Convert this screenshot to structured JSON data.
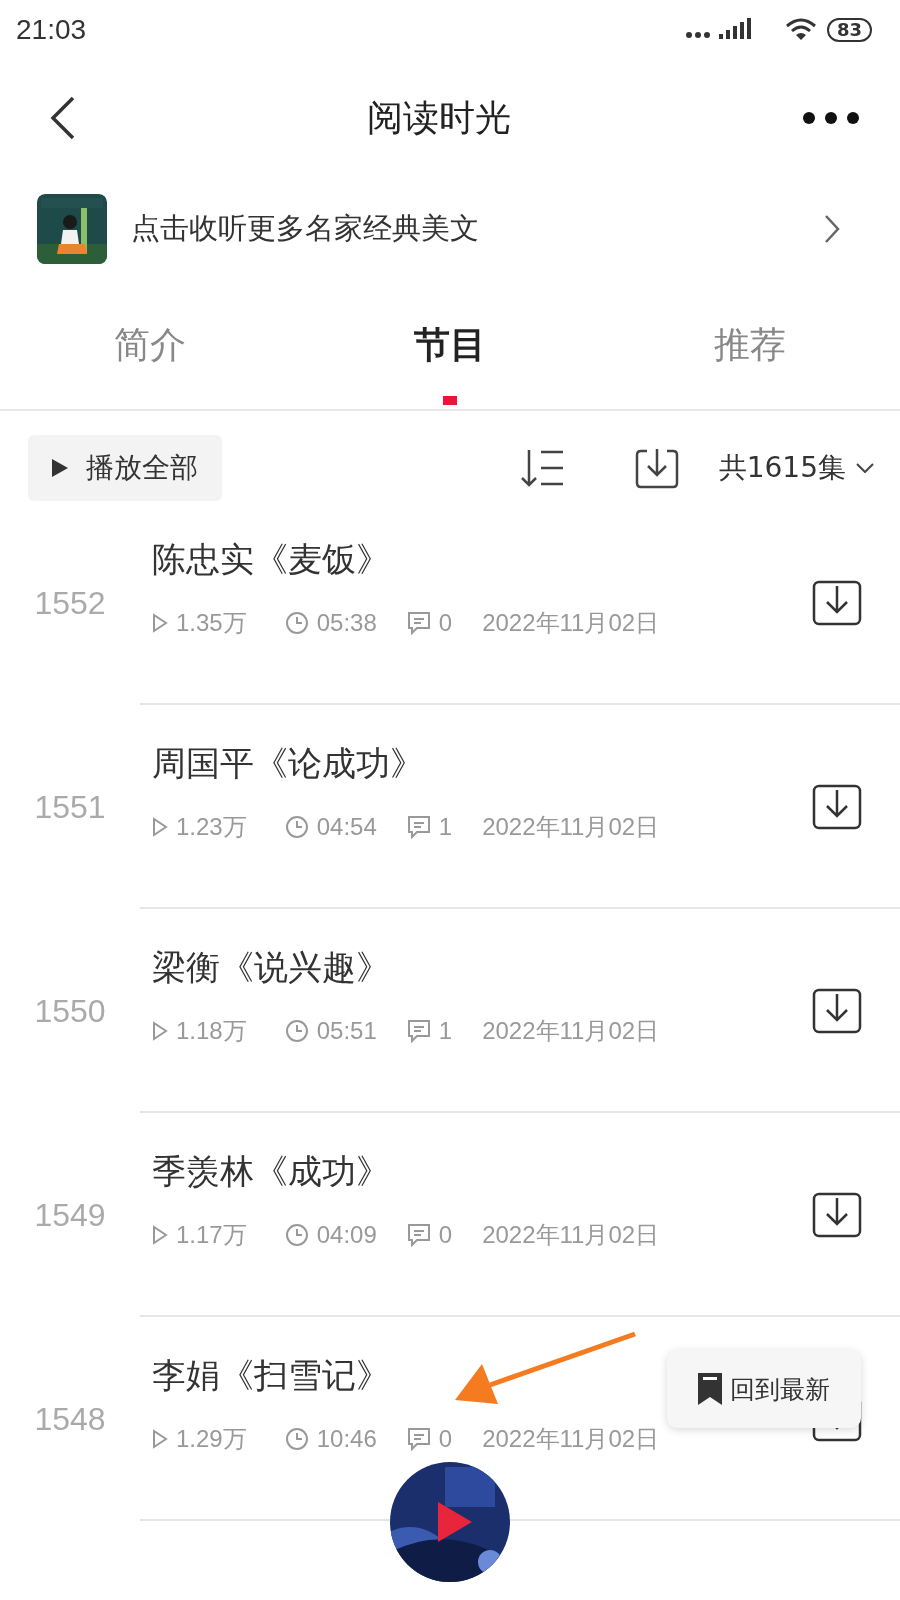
{
  "status_bar": {
    "time": "21:03",
    "battery": "83"
  },
  "nav": {
    "title": "阅读时光"
  },
  "banner": {
    "text": "点击收听更多名家经典美文"
  },
  "tabs": [
    {
      "label": "简介",
      "selected": false
    },
    {
      "label": "节目",
      "selected": true
    },
    {
      "label": "推荐",
      "selected": false
    }
  ],
  "toolbar": {
    "play_all": "播放全部",
    "count": "共1615集"
  },
  "episodes": [
    {
      "number": "1552",
      "title": "陈忠实《麦饭》",
      "plays": "1.35万",
      "duration": "05:38",
      "comments": "0",
      "date": "2022年11月02日"
    },
    {
      "number": "1551",
      "title": "周国平《论成功》",
      "plays": "1.23万",
      "duration": "04:54",
      "comments": "1",
      "date": "2022年11月02日"
    },
    {
      "number": "1550",
      "title": "梁衡《说兴趣》",
      "plays": "1.18万",
      "duration": "05:51",
      "comments": "1",
      "date": "2022年11月02日"
    },
    {
      "number": "1549",
      "title": "季羡林《成功》",
      "plays": "1.17万",
      "duration": "04:09",
      "comments": "0",
      "date": "2022年11月02日"
    },
    {
      "number": "1548",
      "title": "李娟《扫雪记》",
      "plays": "1.29万",
      "duration": "10:46",
      "comments": "0",
      "date": "2022年11月02日"
    }
  ],
  "back_to_latest": "回到最新"
}
